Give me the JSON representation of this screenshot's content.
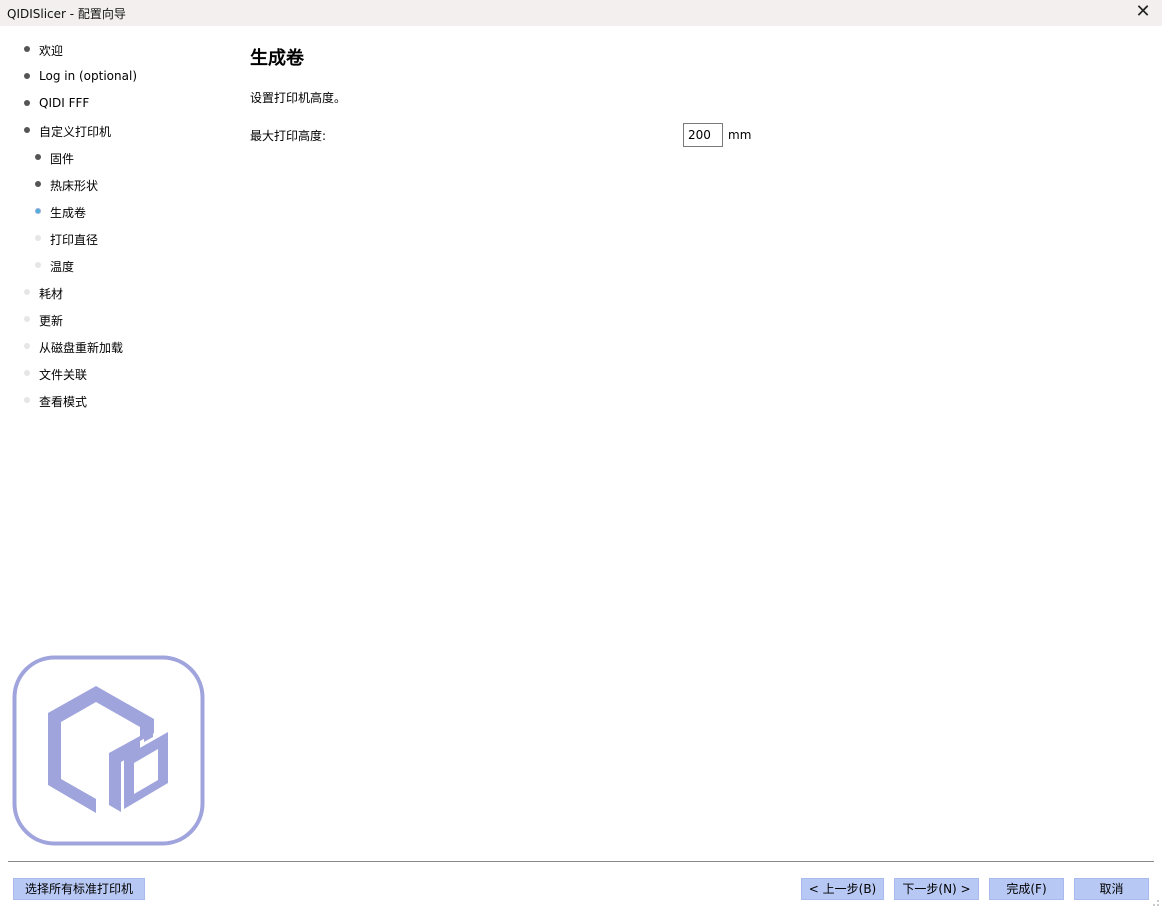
{
  "window": {
    "title": "QIDISlicer - 配置向导",
    "close_glyph": "✕"
  },
  "nav": {
    "items": [
      {
        "label": "欢迎",
        "state": "done"
      },
      {
        "label": "Log in (optional)",
        "state": "done"
      },
      {
        "label": "QIDI FFF",
        "state": "done"
      },
      {
        "label": "自定义打印机",
        "state": "done"
      },
      {
        "label": "固件",
        "state": "done"
      },
      {
        "label": "热床形状",
        "state": "done"
      },
      {
        "label": "生成卷",
        "state": "active"
      },
      {
        "label": "打印直径",
        "state": "todo"
      },
      {
        "label": "温度",
        "state": "todo"
      },
      {
        "label": "耗材",
        "state": "todo"
      },
      {
        "label": "更新",
        "state": "todo"
      },
      {
        "label": "从磁盘重新加载",
        "state": "todo"
      },
      {
        "label": "文件关联",
        "state": "todo"
      },
      {
        "label": "查看模式",
        "state": "todo"
      }
    ]
  },
  "page": {
    "title": "生成卷",
    "description": "设置打印机高度。",
    "max_height_label": "最大打印高度:",
    "max_height_value": "200",
    "unit": "mm"
  },
  "footer": {
    "select_all_label": "选择所有标准打印机",
    "prev_label": "< 上一步(B)",
    "next_label": "下一步(N) >",
    "finish_label": "完成(F)",
    "cancel_label": "取消"
  },
  "colors": {
    "logo": "#a0a4dc",
    "button_bg": "#b8c8f4",
    "active_dot": "#4db0d9",
    "titlebar_bg": "#f3efef"
  },
  "icons": {
    "logo": "qidi-cube-logo-icon",
    "close": "close-icon"
  }
}
